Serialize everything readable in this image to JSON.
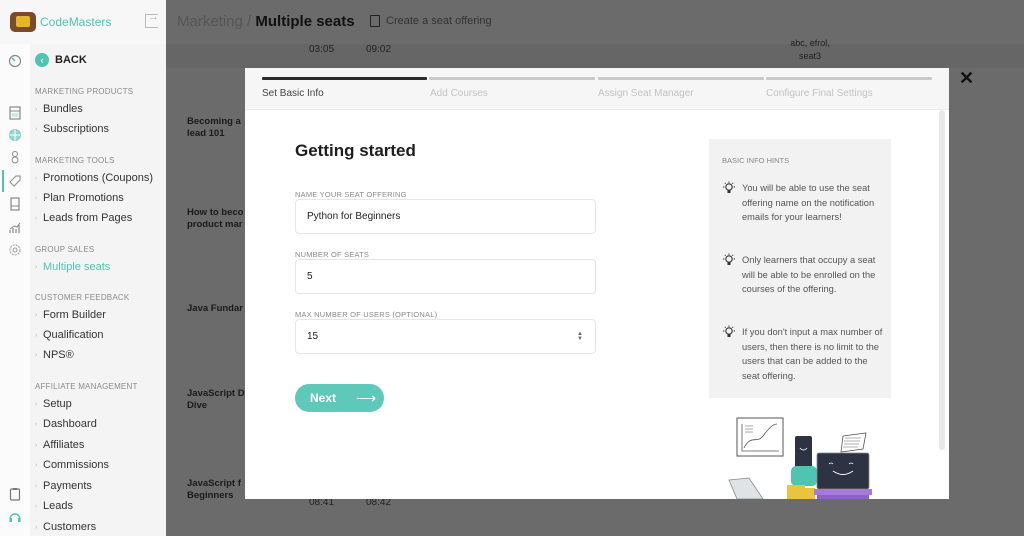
{
  "app": {
    "brand_name": "CodeMasters"
  },
  "sidebar": {
    "back_label": "BACK",
    "sections": [
      {
        "title": "MARKETING PRODUCTS",
        "items": [
          "Bundles",
          "Subscriptions"
        ]
      },
      {
        "title": "MARKETING TOOLS",
        "items": [
          "Promotions (Coupons)",
          "Plan Promotions",
          "Leads from Pages"
        ]
      },
      {
        "title": "GROUP SALES",
        "items": [
          "Multiple seats"
        ]
      },
      {
        "title": "CUSTOMER FEEDBACK",
        "items": [
          "Form Builder",
          "Qualification",
          "NPS®"
        ]
      },
      {
        "title": "AFFILIATE MANAGEMENT",
        "items": [
          "Setup",
          "Dashboard",
          "Affiliates",
          "Commissions",
          "Payments",
          "Leads",
          "Customers"
        ]
      }
    ],
    "active_item": "Multiple seats",
    "rail_icons": [
      "history-icon",
      "calculator-icon",
      "globe-icon",
      "user-icon",
      "tag-icon",
      "tablet-icon",
      "analytics-icon",
      "gear-icon",
      "clipboard-icon",
      "headset-icon"
    ]
  },
  "background_page": {
    "breadcrumb_parent": "Marketing",
    "breadcrumb_separator": "/",
    "breadcrumb_current": "Multiple seats",
    "create_link": "Create a seat offering",
    "top_row_times": [
      "03:05",
      "09:02"
    ],
    "top_row_note_line1": "abc, efrol,",
    "top_row_note_line2": "seat3",
    "rows": [
      {
        "name_line1": "Becoming a",
        "name_line2": "lead 101"
      },
      {
        "name_line1": "How to beco",
        "name_line2": "product mar"
      },
      {
        "name_line1": "Java Fundar",
        "name_line2": ""
      },
      {
        "name_line1": "JavaScript D",
        "name_line2": "Dive"
      },
      {
        "name_line1": "JavaScript f",
        "name_line2": "Beginners"
      }
    ],
    "bottom_row_times": [
      "08:41",
      "08:42"
    ]
  },
  "modal": {
    "steps": [
      {
        "label": "Set Basic Info",
        "active": true
      },
      {
        "label": "Add Courses",
        "active": false
      },
      {
        "label": "Assign Seat Manager",
        "active": false
      },
      {
        "label": "Configure Final Settings",
        "active": false
      }
    ],
    "title": "Getting started",
    "fields": {
      "name": {
        "label": "NAME YOUR SEAT OFFERING",
        "value": "Python for Beginners"
      },
      "seats": {
        "label": "NUMBER OF SEATS",
        "value": "5"
      },
      "max_users": {
        "label": "MAX NUMBER OF USERS (OPTIONAL)",
        "value": "15"
      }
    },
    "next_label": "Next",
    "next_arrow": "⟶",
    "hints": {
      "title": "BASIC INFO HINTS",
      "items": [
        "You will be able to use the seat offering name on the notification emails for your learners!",
        "Only learners that occupy a seat will be able to be enrolled on the courses of the offering.",
        "If you don't input a max number of users, then there is no limit to the users that can be added to the seat offering."
      ]
    },
    "close_label": "✕"
  },
  "colors": {
    "accent": "#4fc4b1",
    "button": "#5ec9b8",
    "overlay": "#6b6b6b"
  }
}
